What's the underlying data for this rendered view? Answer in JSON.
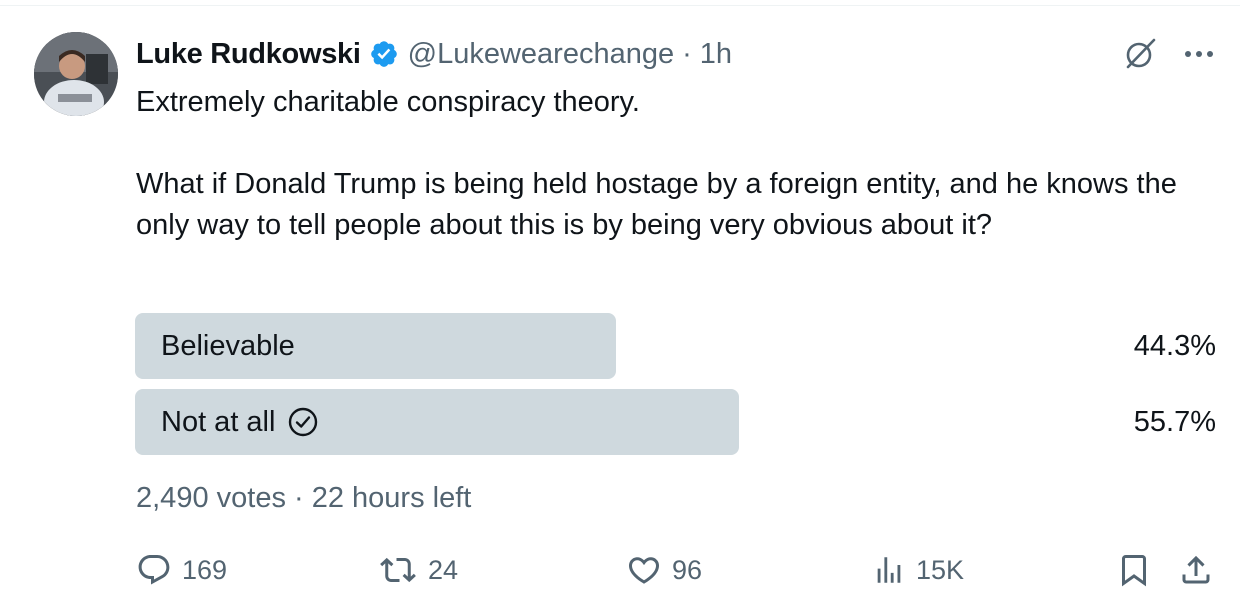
{
  "tweet": {
    "author_name": "Luke Rudkowski",
    "handle": "@Lukewearechange",
    "separator": "·",
    "time": "1h",
    "text": "Extremely charitable conspiracy theory.\n\nWhat if Donald Trump is being held hostage by a foreign entity, and he knows the only way to tell people about this is by being very obvious about it?"
  },
  "poll": {
    "options": [
      {
        "label": "Believable",
        "percent_text": "44.3%",
        "percent": 44.3,
        "selected": false
      },
      {
        "label": "Not at all",
        "percent_text": "55.7%",
        "percent": 55.7,
        "selected": true
      }
    ],
    "meta": "2,490 votes · 22 hours left"
  },
  "actions": {
    "replies": "169",
    "reposts": "24",
    "likes": "96",
    "views": "15K"
  },
  "icons": {
    "verified": "verified-badge-icon",
    "grok": "grok-icon",
    "more": "more-icon",
    "check": "check-circle-icon",
    "reply": "reply-icon",
    "repost": "repost-icon",
    "like": "heart-icon",
    "views": "views-icon",
    "bookmark": "bookmark-icon",
    "share": "share-icon"
  },
  "colors": {
    "verified": "#1d9bf0",
    "poll_bar": "#cfd9de",
    "muted_text": "#536471",
    "text": "#0f1419"
  }
}
